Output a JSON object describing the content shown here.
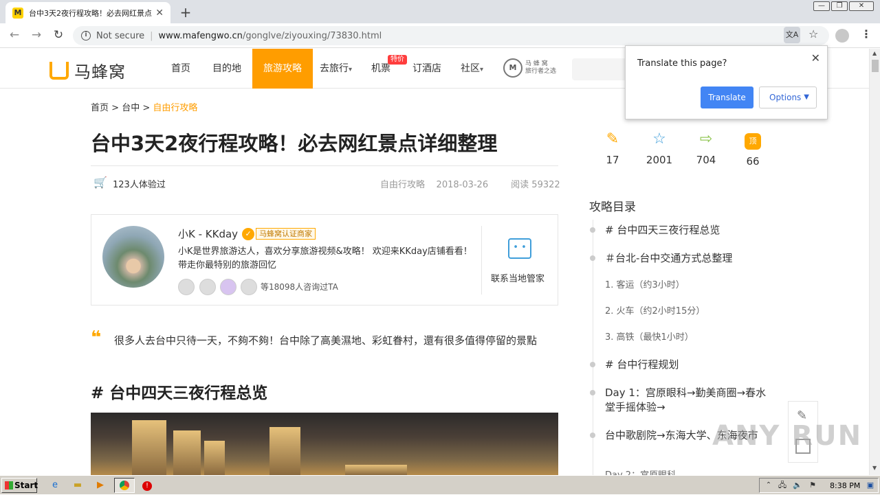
{
  "browser": {
    "tab_title": "台中3天2夜行程攻略！必去网红景点",
    "tab_close": "✕",
    "new_tab": "+",
    "back": "←",
    "forward": "→",
    "reload": "↻",
    "not_secure": "Not secure",
    "url_host": "www.mafengwo.cn",
    "url_path": "/gonglve/ziyouxing/73830.html",
    "bookmark": "☆",
    "menu": "⋮",
    "win_min": "—",
    "win_max": "❐",
    "win_close": "✕"
  },
  "site": {
    "logo_text": "马蜂窝",
    "nav": [
      "首页",
      "目的地",
      "旅游攻略",
      "去旅行",
      "机票",
      "订酒店",
      "社区"
    ],
    "nav_dropdown": "▾",
    "tejia_badge": "特价",
    "slogan_logo_char": "M",
    "slogan_line1": "马 蜂 窝",
    "slogan_line2": "旅行者之选"
  },
  "article": {
    "breadcrumb": [
      "首页",
      "台中",
      "自由行攻略"
    ],
    "breadcrumb_sep": ">",
    "title": "台中3天2夜行程攻略！必去网红景点详细整理",
    "verified": "123人体验过",
    "category": "自由行攻略",
    "date": "2018-03-26",
    "views": "阅读 59322",
    "intro": "很多人去台中只待一天，不夠不夠！台中除了高美濕地、彩虹眷村，還有很多值得停留的景點",
    "heading1": "# 台中四天三夜行程总览"
  },
  "author": {
    "name": "小K - KKday",
    "cert": "马蜂窝认证商家",
    "desc": "小K是世界旅游达人，喜欢分享旅游视频&攻略！ 欢迎来KKday店铺看看！带走你最特别的旅游回忆",
    "consulted": "等18098人咨询过TA",
    "contact": "联系当地管家"
  },
  "stats": [
    {
      "icon": "edit-icon",
      "glyph": "✎",
      "value": "17",
      "color": "#ffa800"
    },
    {
      "icon": "star-icon",
      "glyph": "☆",
      "value": "2001",
      "color": "#3f9eda"
    },
    {
      "icon": "share-icon",
      "glyph": "⇨",
      "value": "704",
      "color": "#8bc34a"
    },
    {
      "icon": "top-icon",
      "glyph": "顶",
      "value": "66",
      "color": "#ffa800"
    }
  ],
  "toc": {
    "heading": "攻略目录",
    "items": [
      "# 台中四天三夜行程总览",
      "＃台北-台中交通方式总整理",
      "1. 客运（约3小时）",
      "2. 火车（约2小时15分）",
      "3. 高铁（最快1小时）",
      "# 台中行程规划",
      "Day 1：宫原眼科→勤美商圈→春水堂手摇体验→",
      "台中歌剧院→东海大学、东海夜市",
      "Day 2：宫原眼科"
    ]
  },
  "translate": {
    "question": "Translate this page?",
    "translate_btn": "Translate",
    "options_btn": "Options",
    "close": "✕"
  },
  "watermark": "ANY RUN",
  "taskbar": {
    "start": "Start",
    "clock": "8:38 PM"
  }
}
